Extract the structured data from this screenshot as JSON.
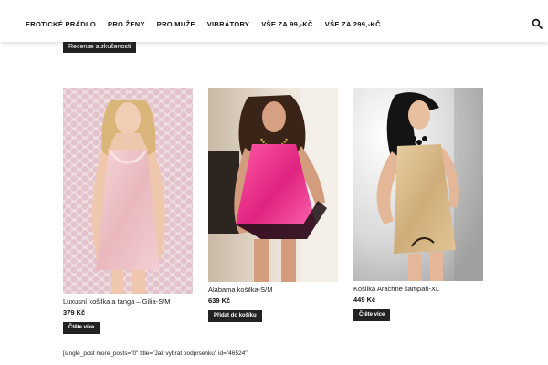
{
  "nav": {
    "items": [
      "EROTICKÉ PRÁDLO",
      "PRO ŽENY",
      "PRO MUŽE",
      "VIBRÁTORY",
      "VŠE ZA 99,-KČ",
      "VŠE ZA 299,-KČ"
    ]
  },
  "review_button": "Recenze a zkušenosti",
  "products": [
    {
      "title": "Luxusní košilka a tanga – Gilia-S/M",
      "price": "379 Kč",
      "button": "Čtěte více"
    },
    {
      "title": "Alabama košilka-S/M",
      "price": "639 Kč",
      "button": "Přidat do košíku"
    },
    {
      "title": "Košilka Arachne šampaň-XL",
      "price": "449 Kč",
      "button": "Čtěte více"
    }
  ],
  "shortcode_text": "[single_post more_posts=\"0\" title=\"Jak vybrat podprsenku\" id=\"46524\"]",
  "colors": {
    "nav_text": "#111111",
    "button_bg": "#222222",
    "button_text": "#ffffff"
  }
}
